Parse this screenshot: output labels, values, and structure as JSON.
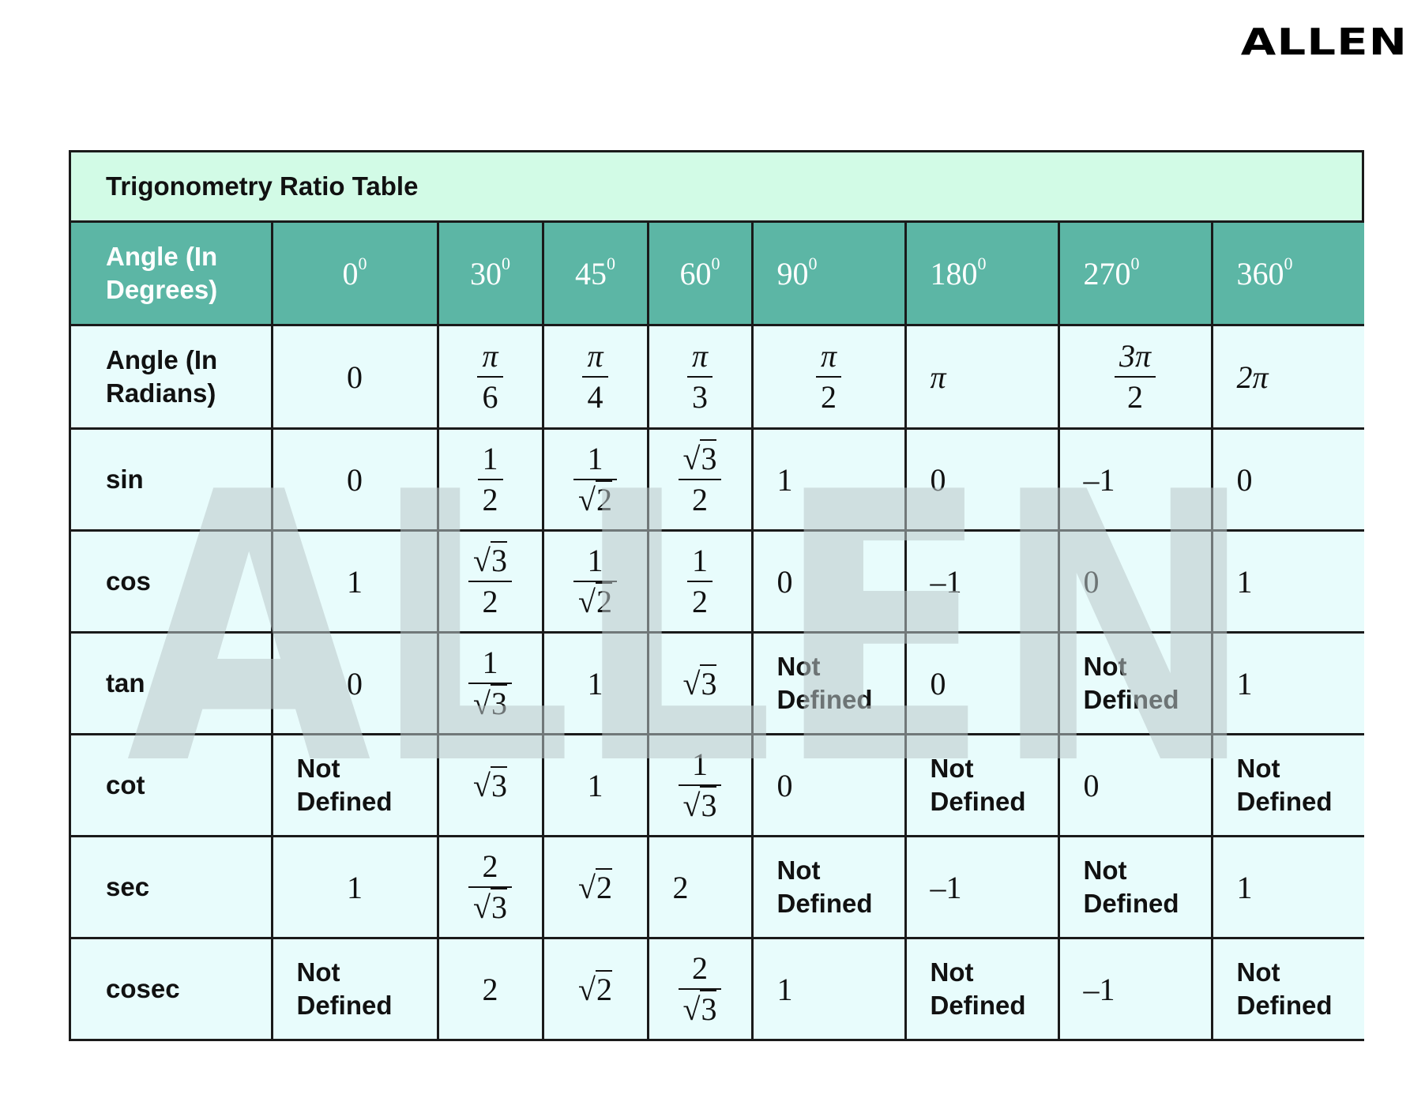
{
  "brand": {
    "logo_text": "ALLEN",
    "watermark_text": "ALLEN"
  },
  "colors": {
    "title_bg": "#d2fbe6",
    "header_bg": "#5cb6a5",
    "cell_bg": "#e8fcfc",
    "border": "#1a1a1a",
    "watermark": "#b9c6c8"
  },
  "table": {
    "title": "Trigonometry Ratio Table",
    "header": {
      "label_line1": "Angle (In",
      "label_line2": "Degrees)",
      "degree_symbol": "0",
      "degrees": [
        "0",
        "30",
        "45",
        "60",
        "90",
        "180",
        "270",
        "360"
      ]
    },
    "radians": {
      "label_line1": "Angle (In",
      "label_line2": "Radians)",
      "values": [
        {
          "type": "plain",
          "text": "0"
        },
        {
          "type": "frac",
          "num": "π",
          "den": "6"
        },
        {
          "type": "frac",
          "num": "π",
          "den": "4"
        },
        {
          "type": "frac",
          "num": "π",
          "den": "3"
        },
        {
          "type": "frac",
          "num": "π",
          "den": "2"
        },
        {
          "type": "plain",
          "text": "π"
        },
        {
          "type": "frac",
          "num": "3π",
          "den": "2"
        },
        {
          "type": "plain",
          "text": "2π"
        }
      ]
    },
    "rows": [
      {
        "label": "sin",
        "values": [
          {
            "type": "plain",
            "text": "0"
          },
          {
            "type": "frac",
            "num": "1",
            "den": "2"
          },
          {
            "type": "frac",
            "num": "1",
            "den_sqrt": "2"
          },
          {
            "type": "frac",
            "num_sqrt": "3",
            "den": "2"
          },
          {
            "type": "plain",
            "text": "1"
          },
          {
            "type": "plain",
            "text": "0"
          },
          {
            "type": "plain",
            "text": "–1"
          },
          {
            "type": "plain",
            "text": "0"
          }
        ]
      },
      {
        "label": "cos",
        "values": [
          {
            "type": "plain",
            "text": "1"
          },
          {
            "type": "frac",
            "num_sqrt": "3",
            "den": "2"
          },
          {
            "type": "frac",
            "num": "1",
            "den_sqrt": "2"
          },
          {
            "type": "frac",
            "num": "1",
            "den": "2"
          },
          {
            "type": "plain",
            "text": "0"
          },
          {
            "type": "plain",
            "text": "–1"
          },
          {
            "type": "plain",
            "text": "0"
          },
          {
            "type": "plain",
            "text": "1"
          }
        ]
      },
      {
        "label": "tan",
        "values": [
          {
            "type": "plain",
            "text": "0"
          },
          {
            "type": "frac",
            "num": "1",
            "den_sqrt": "3"
          },
          {
            "type": "plain",
            "text": "1"
          },
          {
            "type": "sqrt",
            "text": "3"
          },
          {
            "type": "nd",
            "line1": "Not",
            "line2": "Defined"
          },
          {
            "type": "plain",
            "text": "0"
          },
          {
            "type": "nd",
            "line1": "Not",
            "line2": "Defined"
          },
          {
            "type": "plain",
            "text": "1"
          }
        ]
      },
      {
        "label": "cot",
        "values": [
          {
            "type": "nd",
            "line1": "Not",
            "line2": "Defined"
          },
          {
            "type": "sqrt",
            "text": "3"
          },
          {
            "type": "plain",
            "text": "1"
          },
          {
            "type": "frac",
            "num": "1",
            "den_sqrt": "3"
          },
          {
            "type": "plain",
            "text": "0"
          },
          {
            "type": "nd",
            "line1": "Not",
            "line2": "Defined"
          },
          {
            "type": "plain",
            "text": "0"
          },
          {
            "type": "nd",
            "line1": "Not",
            "line2": "Defined"
          }
        ]
      },
      {
        "label": "sec",
        "values": [
          {
            "type": "plain",
            "text": "1"
          },
          {
            "type": "frac",
            "num": "2",
            "den_sqrt": "3"
          },
          {
            "type": "sqrt",
            "text": "2"
          },
          {
            "type": "plain",
            "text": "2"
          },
          {
            "type": "nd",
            "line1": "Not",
            "line2": "Defined"
          },
          {
            "type": "plain",
            "text": "–1"
          },
          {
            "type": "nd",
            "line1": "Not",
            "line2": "Defined"
          },
          {
            "type": "plain",
            "text": "1"
          }
        ]
      },
      {
        "label": "cosec",
        "values": [
          {
            "type": "nd",
            "line1": "Not",
            "line2": "Defined"
          },
          {
            "type": "plain",
            "text": "2"
          },
          {
            "type": "sqrt",
            "text": "2"
          },
          {
            "type": "frac",
            "num": "2",
            "den_sqrt": "3"
          },
          {
            "type": "plain",
            "text": "1"
          },
          {
            "type": "nd",
            "line1": "Not",
            "line2": "Defined"
          },
          {
            "type": "plain",
            "text": "–1"
          },
          {
            "type": "nd",
            "line1": "Not",
            "line2": "Defined"
          }
        ]
      }
    ]
  }
}
